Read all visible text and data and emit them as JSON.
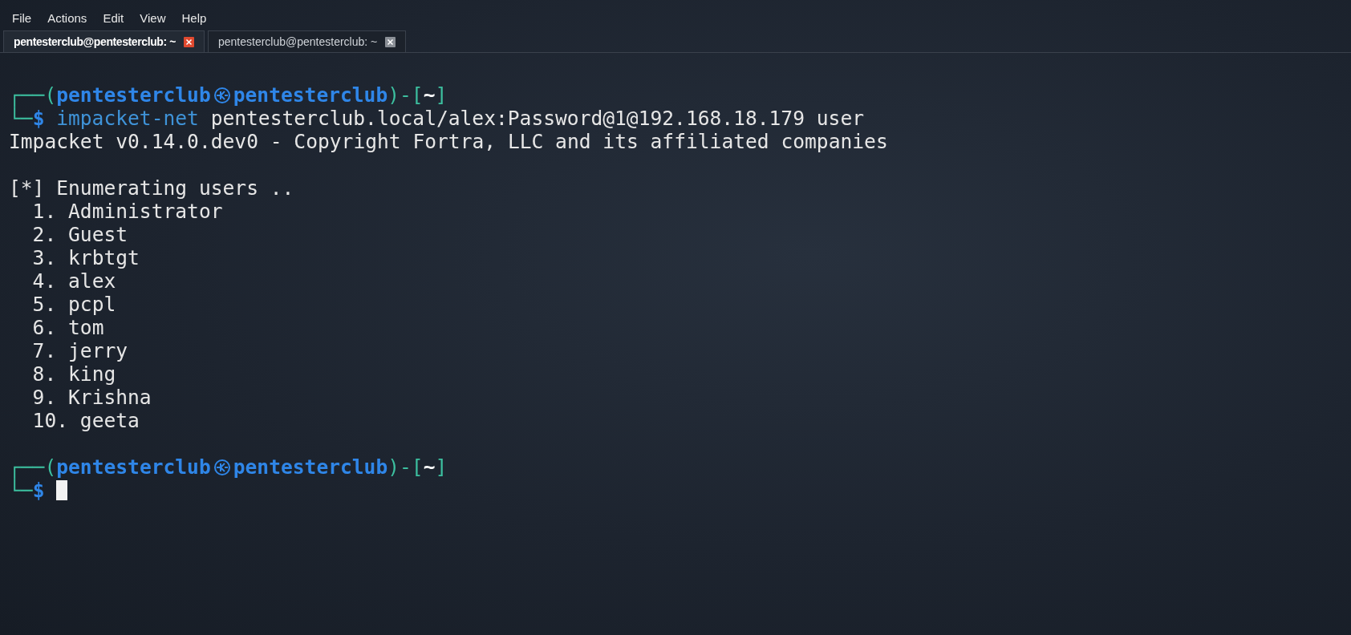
{
  "menu": [
    "File",
    "Actions",
    "Edit",
    "View",
    "Help"
  ],
  "tabs": [
    {
      "label": "pentesterclub@pentesterclub: ~",
      "selected": true
    },
    {
      "label": "pentesterclub@pentesterclub: ~",
      "selected": false
    }
  ],
  "terminal": {
    "lines": [
      {
        "kind": "prompt",
        "frame_top": "┌──(",
        "user": "pentesterclub",
        "host": "pentesterclub",
        "open_dir": ")-[",
        "dir": "~",
        "close_dir": "]",
        "frame_bottom": "└─",
        "sign": "$",
        "command": "impacket-net",
        "args": "pentesterclub.local/alex:Password@1@192.168.18.179 user"
      },
      {
        "kind": "output",
        "text": "Impacket v0.14.0.dev0 - Copyright Fortra, LLC and its affiliated companies"
      },
      {
        "kind": "blank"
      },
      {
        "kind": "output",
        "text": "[*] Enumerating users .."
      },
      {
        "kind": "output",
        "text": "  1. Administrator"
      },
      {
        "kind": "output",
        "text": "  2. Guest"
      },
      {
        "kind": "output",
        "text": "  3. krbtgt"
      },
      {
        "kind": "output",
        "text": "  4. alex"
      },
      {
        "kind": "output",
        "text": "  5. pcpl"
      },
      {
        "kind": "output",
        "text": "  6. tom"
      },
      {
        "kind": "output",
        "text": "  7. jerry"
      },
      {
        "kind": "output",
        "text": "  8. king"
      },
      {
        "kind": "output",
        "text": "  9. Krishna"
      },
      {
        "kind": "output",
        "text": "  10. geeta"
      },
      {
        "kind": "blank"
      },
      {
        "kind": "prompt",
        "frame_top": "┌──(",
        "user": "pentesterclub",
        "host": "pentesterclub",
        "open_dir": ")-[",
        "dir": "~",
        "close_dir": "]",
        "frame_bottom": "└─",
        "sign": "$",
        "cursor": true
      }
    ]
  }
}
